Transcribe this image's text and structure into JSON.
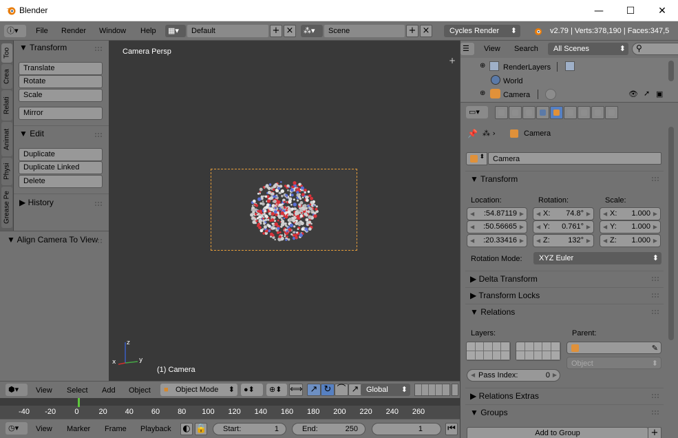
{
  "window": {
    "title": "Blender",
    "minimize": "—",
    "maximize": "☐",
    "close": "✕"
  },
  "info_header": {
    "menus": [
      "File",
      "Render",
      "Window",
      "Help"
    ],
    "screen_layout": "Default",
    "scene": "Scene",
    "render_engine": "Cycles Render",
    "stats": "v2.79 | Verts:378,190 | Faces:347,5"
  },
  "toolshelf": {
    "tabs": [
      "Too",
      "Crea",
      "Relati",
      "Animat",
      "Physi",
      "Grease Pe"
    ],
    "transform_header": "Transform",
    "transform_buttons": [
      "Translate",
      "Rotate",
      "Scale"
    ],
    "mirror_button": "Mirror",
    "edit_header": "Edit",
    "edit_buttons": [
      "Duplicate",
      "Duplicate Linked",
      "Delete"
    ],
    "history_header": "History",
    "operator_panel": "Align Camera To View"
  },
  "viewport": {
    "view_label": "Camera Persp",
    "object_label": "(1) Camera",
    "axes": {
      "x": "x",
      "y": "y",
      "z": "z"
    },
    "header_menus": [
      "View",
      "Select",
      "Add",
      "Object"
    ],
    "mode": "Object Mode",
    "orientation": "Global"
  },
  "timeline": {
    "ticks": [
      "-40",
      "-20",
      "0",
      "20",
      "40",
      "60",
      "80",
      "100",
      "120",
      "140",
      "160",
      "180",
      "200",
      "220",
      "240",
      "260"
    ],
    "current_frame_marker": 0,
    "header_menus": [
      "View",
      "Marker",
      "Frame",
      "Playback"
    ],
    "start_label": "Start:",
    "start_value": "1",
    "end_label": "End:",
    "end_value": "250",
    "current_frame": "1"
  },
  "outliner": {
    "menus": [
      "View",
      "Search"
    ],
    "filter": "All Scenes",
    "items": [
      "RenderLayers",
      "World",
      "Camera"
    ]
  },
  "properties": {
    "breadcrumb": "Camera",
    "object_name": "Camera",
    "transform_header": "Transform",
    "location_label": "Location:",
    "rotation_label": "Rotation:",
    "scale_label": "Scale:",
    "location": [
      ":54.87119",
      ":50.56665",
      ":20.33416"
    ],
    "rotation": [
      {
        "axis": "X:",
        "value": "74.8°"
      },
      {
        "axis": "Y:",
        "value": "0.761°"
      },
      {
        "axis": "Z:",
        "value": "132°"
      }
    ],
    "scale": [
      {
        "axis": "X:",
        "value": "1.000"
      },
      {
        "axis": "Y:",
        "value": "1.000"
      },
      {
        "axis": "Z:",
        "value": "1.000"
      }
    ],
    "rotation_mode_label": "Rotation Mode:",
    "rotation_mode": "XYZ Euler",
    "delta_transform": "Delta Transform",
    "transform_locks": "Transform Locks",
    "relations": "Relations",
    "layers_label": "Layers:",
    "parent_label": "Parent:",
    "parent_type": "Object",
    "pass_index_label": "Pass Index:",
    "pass_index": "0",
    "relations_extras": "Relations Extras",
    "groups": "Groups",
    "add_to_group": "Add to Group"
  }
}
